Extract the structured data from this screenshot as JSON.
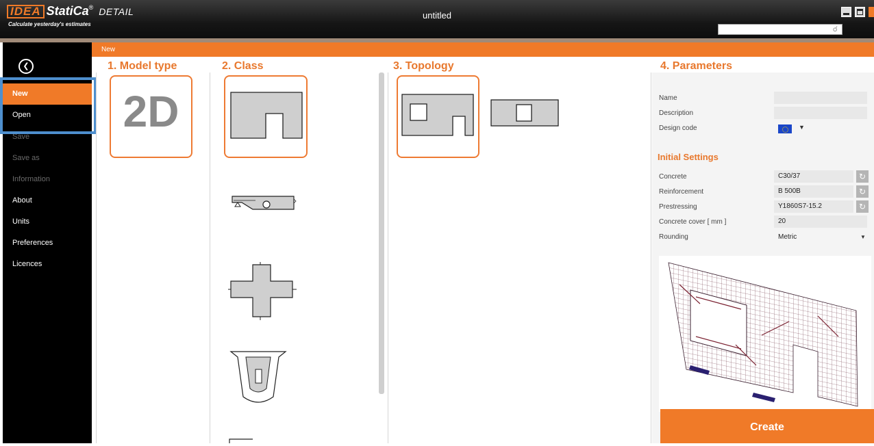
{
  "app": {
    "logo_brand": "IDEA",
    "logo_name": "StatiCa",
    "logo_reg": "®",
    "product": "DETAIL",
    "tagline": "Calculate yesterday's estimates",
    "window_title": "untitled",
    "search_icon": "magnifier-icon"
  },
  "sidebar": {
    "back_icon": "back-arrow-icon",
    "back_glyph": "❮",
    "items": [
      {
        "label": "New"
      },
      {
        "label": "Open"
      },
      {
        "label": "Save"
      },
      {
        "label": "Save as"
      },
      {
        "label": "Information"
      },
      {
        "label": "About"
      },
      {
        "label": "Units"
      },
      {
        "label": "Preferences"
      },
      {
        "label": "Licences"
      }
    ]
  },
  "breadcrumb": "New",
  "columns": {
    "model_type": "1. Model type",
    "class": "2. Class",
    "topology": "3. Topology",
    "parameters": "4. Parameters"
  },
  "model_type": {
    "selected": "2D"
  },
  "parameters": {
    "name_label": "Name",
    "name_value": "",
    "description_label": "Description",
    "description_value": "",
    "design_code_label": "Design code",
    "design_code_icon": "eu-flag-icon",
    "settings_title": "Initial Settings",
    "concrete_label": "Concrete",
    "concrete_value": "C30/37",
    "reinforcement_label": "Reinforcement",
    "reinforcement_value": "B 500B",
    "prestressing_label": "Prestressing",
    "prestressing_value": "Y1860S7-15.2",
    "cover_label": "Concrete cover  [ mm ]",
    "cover_value": "20",
    "rounding_label": "Rounding",
    "rounding_value": "Metric",
    "refresh_glyph": "↻",
    "caret_glyph": "▼"
  },
  "create_label": "Create",
  "colors": {
    "accent": "#f07a28",
    "selection_frame": "#4e8fce",
    "sidebar_bg": "#000000"
  }
}
